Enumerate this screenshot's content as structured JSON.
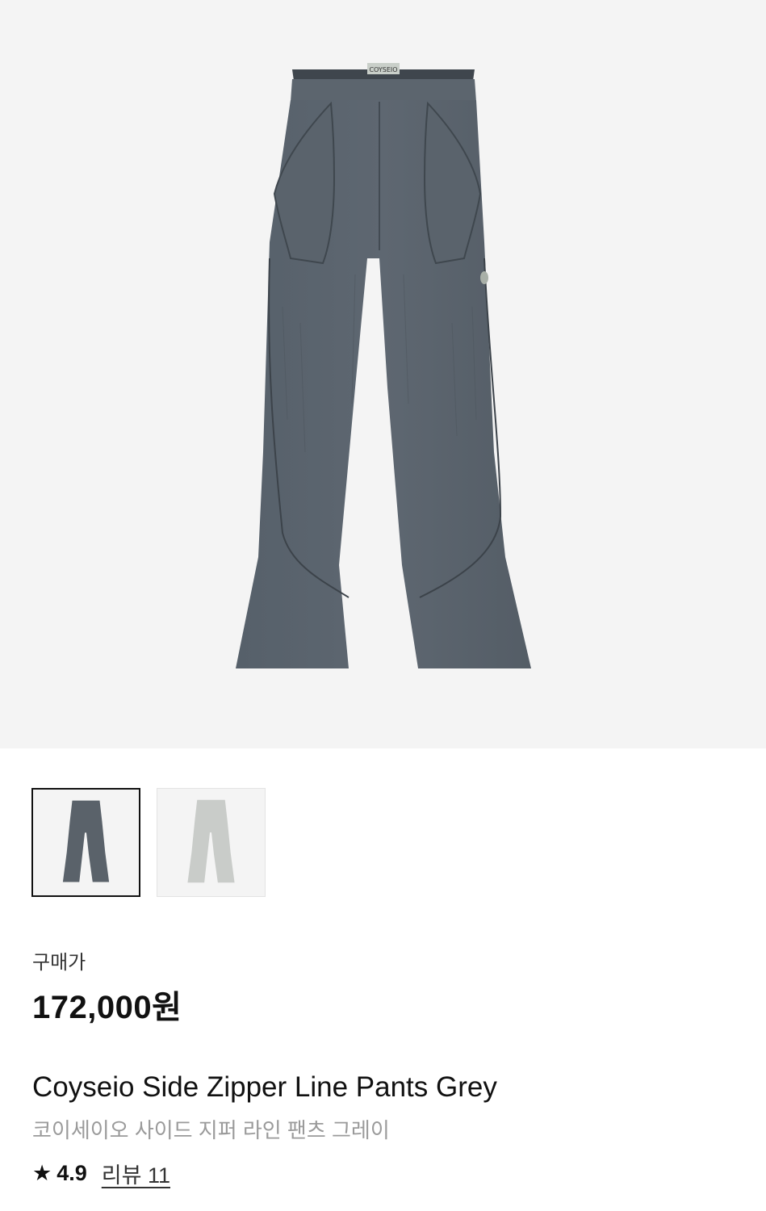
{
  "product": {
    "price_label": "구매가",
    "price": "172,000원",
    "name_en": "Coyseio Side Zipper Line Pants Grey",
    "name_ko": "코이세이오 사이드 지퍼 라인 팬츠 그레이",
    "rating": "4.9",
    "reviews_label": "리뷰 11",
    "brand_tag": "COYSEIO"
  },
  "images": {
    "main_color": "#5a626a",
    "thumbnails": [
      {
        "color": "#5a626a",
        "selected": true
      },
      {
        "color": "#c9ccc9",
        "selected": false
      }
    ]
  },
  "icons": {
    "star": "star-icon"
  }
}
